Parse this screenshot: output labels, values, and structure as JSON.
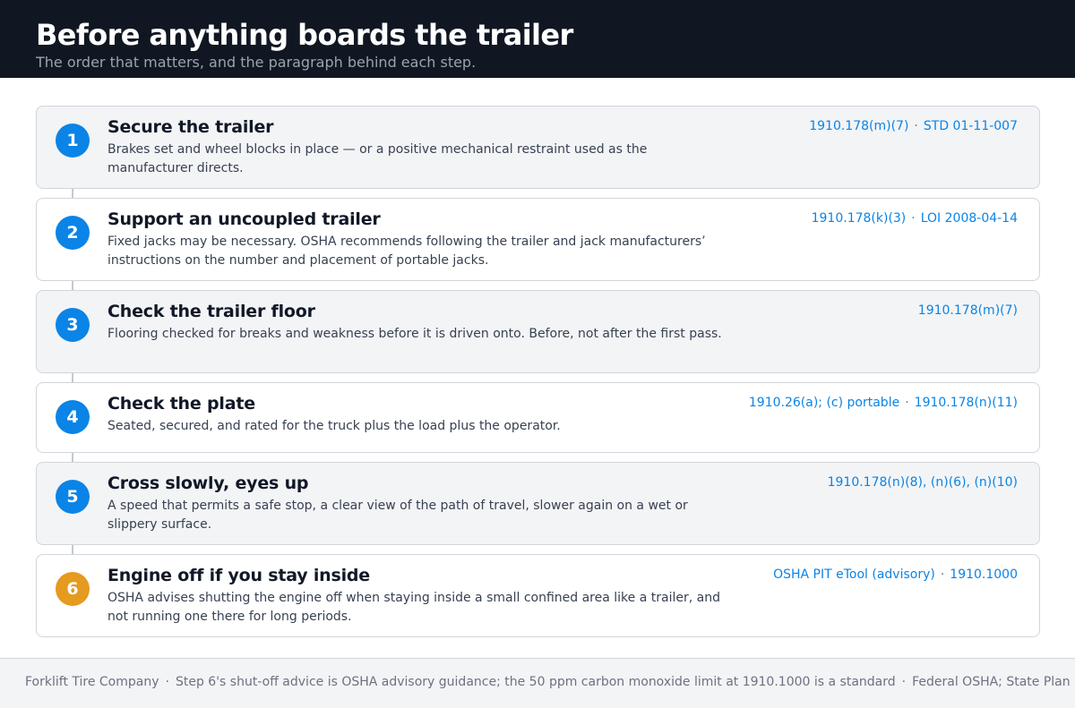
{
  "header": {
    "title": "Before anything boards the trailer",
    "subtitle": "The order that matters, and the paragraph behind each step."
  },
  "colors": {
    "header_bg": "#111722",
    "accent_blue": "#0a84e6",
    "accent_orange": "#e59a20",
    "shaded_card": "#f3f4f6"
  },
  "steps": [
    {
      "number": "1",
      "title": "Secure the trailer",
      "description": "Brakes set and wheel blocks in place — or a positive mechanical restraint used as the manufacturer directs.",
      "refs": [
        "1910.178(m)(7)",
        "STD 01-11-007"
      ],
      "badge_color": "#0a84e6"
    },
    {
      "number": "2",
      "title": "Support an uncoupled trailer",
      "description": "Fixed jacks may be necessary. OSHA recommends following the trailer and jack manufacturers’ instructions on the number and placement of portable jacks.",
      "refs": [
        "1910.178(k)(3)",
        "LOI 2008-04-14"
      ],
      "badge_color": "#0a84e6"
    },
    {
      "number": "3",
      "title": "Check the trailer floor",
      "description": "Flooring checked for breaks and weakness before it is driven onto. Before, not after the first pass.",
      "refs": [
        "1910.178(m)(7)"
      ],
      "badge_color": "#0a84e6"
    },
    {
      "number": "4",
      "title": "Check the plate",
      "description": "Seated, secured, and rated for the truck plus the load plus the operator.",
      "refs": [
        "1910.26(a); (c) portable",
        "1910.178(n)(11)"
      ],
      "badge_color": "#0a84e6"
    },
    {
      "number": "5",
      "title": "Cross slowly, eyes up",
      "description": "A speed that permits a safe stop, a clear view of the path of travel, slower again on a wet or slippery surface.",
      "refs": [
        "1910.178(n)(8), (n)(6), (n)(10)"
      ],
      "badge_color": "#0a84e6"
    },
    {
      "number": "6",
      "title": "Engine off if you stay inside",
      "description": "OSHA advises shutting the engine off when staying inside a small confined area like a trailer, and not running one there for long periods.",
      "refs": [
        "OSHA PIT eTool (advisory)",
        "1910.1000"
      ],
      "badge_color": "#e59a20"
    }
  ],
  "footer": {
    "items": [
      "Forklift Tire Company",
      "Step 6's shut-off advice is OSHA advisory guidance; the 50 ppm carbon monoxide limit at 1910.1000 is a standard",
      "Federal OSHA; State Plan states may differ"
    ]
  }
}
